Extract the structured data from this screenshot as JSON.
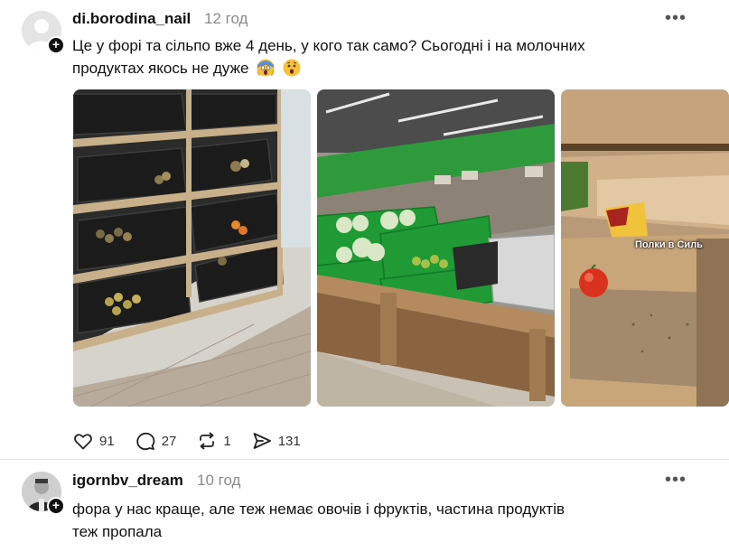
{
  "post": {
    "username": "di.borodina_nail",
    "time": "12 год",
    "text_line1": "Це у форі та сільпо вже 4 день, у кого так само? Сьогодні і на молочних",
    "text_line2": "продуктах якось не дуже",
    "emojis": [
      "screaming-face",
      "worried-face"
    ],
    "images": [
      {
        "alt": "Empty produce crates with a few vegetables"
      },
      {
        "alt": "Green crates with cabbages in supermarket"
      },
      {
        "alt": "Empty cardboard boxes with a tomato",
        "overlay_text": "Полки в Силь"
      }
    ],
    "actions": {
      "like": {
        "icon": "heart-icon",
        "count": "91"
      },
      "comment": {
        "icon": "comment-icon",
        "count": "27"
      },
      "repost": {
        "icon": "repost-icon",
        "count": "1"
      },
      "share": {
        "icon": "send-icon",
        "count": "131"
      }
    }
  },
  "reply": {
    "username": "igornbv_dream",
    "time": "10 год",
    "text_line1": "фора у нас краще, але теж немає овочів і фруктів, частина продуктів",
    "text_line2": "теж пропала"
  },
  "more_label": "•••"
}
